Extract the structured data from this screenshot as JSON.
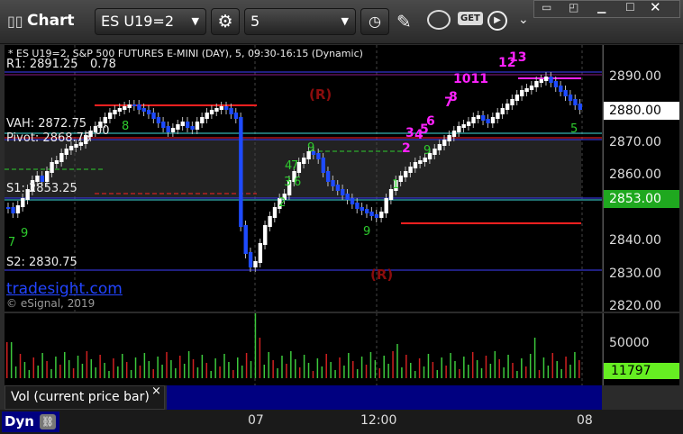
{
  "window": {
    "title": "Chart",
    "symbol": "ES U19=2",
    "interval": "5",
    "get_label": "GET"
  },
  "chart": {
    "header": "* ES U19=2, S&P 500 FUTURES E-MINI (DAY), 5, 09:30-16:15 (Dynamic)",
    "r1": "R1: 2891.25",
    "r1_extra": "0.78",
    "vah": "VAH: 2872.75",
    "vah_extra": "00",
    "pivot": "Pivot: 2868.75",
    "s1": "S1: 2853.25",
    "s2": "S2: 2830.75",
    "watermark": "tradesight.com",
    "copyright": "© eSignal, 2019",
    "r_markers": [
      "(R)",
      "(R)"
    ],
    "counts_magenta": [
      "1011",
      "12",
      "13",
      "8",
      "7",
      "6",
      "5",
      "4",
      "3",
      "2"
    ],
    "counts_green": [
      "8",
      "9",
      "7",
      "4",
      "3",
      "6",
      "2",
      "9",
      "1",
      "9",
      "5",
      "7",
      "9"
    ],
    "price_ticks": [
      "2890.00",
      "2870.00",
      "2860.00",
      "2850.00",
      "2840.00",
      "2830.00",
      "2820.00"
    ],
    "current_price": "2880.00",
    "green_price": "2853.00",
    "colors": {
      "red_line": "#ff2020",
      "blue_candle": "#1e4bff",
      "magenta": "#ff22ff",
      "green": "#2ecc2e",
      "cyan": "#40e0e0"
    }
  },
  "volume": {
    "tick": "50000",
    "current": "11797",
    "label": "Vol (current price bar)",
    "close": "×"
  },
  "time_axis": [
    "07",
    "12:00",
    "08"
  ],
  "bottom": {
    "label": "Dyn"
  }
}
